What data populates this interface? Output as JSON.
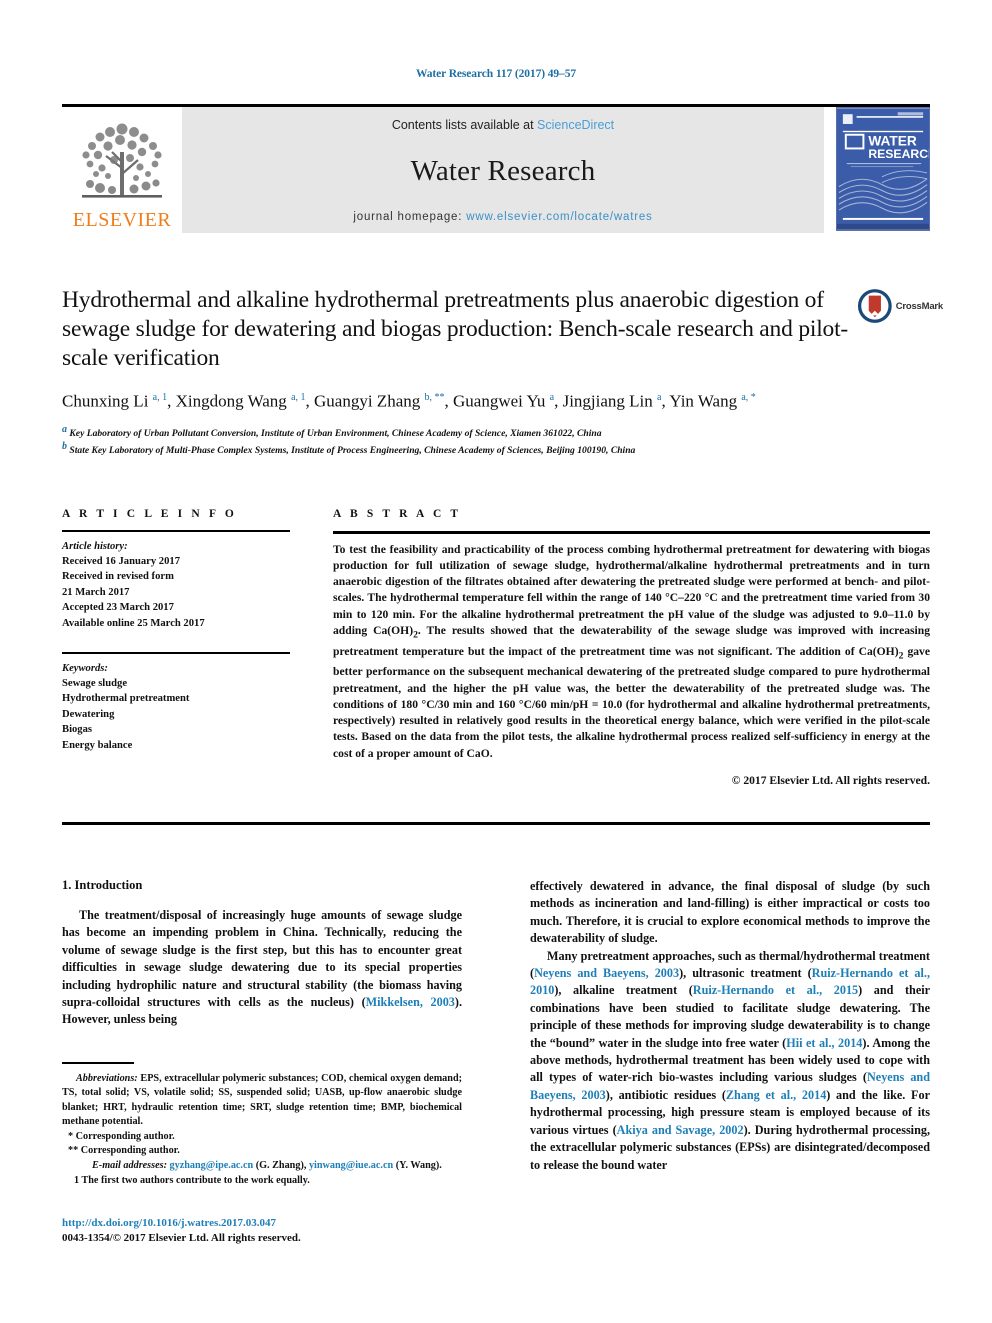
{
  "running_head": "Water Research 117 (2017) 49–57",
  "masthead": {
    "publisher_name": "ELSEVIER",
    "contents_prefix": "Contents lists available at ",
    "contents_link": "ScienceDirect",
    "journal_name": "Water Research",
    "homepage_prefix": "journal homepage: ",
    "homepage_url": "www.elsevier.com/locate/watres",
    "cover_title_line1": "WATER",
    "cover_title_line2": "RESEARCH"
  },
  "crossmark": {
    "label": "CrossMark"
  },
  "article": {
    "title": "Hydrothermal and alkaline hydrothermal pretreatments plus anaerobic digestion of sewage sludge for dewatering and biogas production: Bench-scale research and pilot-scale verification",
    "authors_html": "Chunxing Li <sup>a, 1</sup>, Xingdong Wang <sup>a, 1</sup>, Guangyi Zhang <sup>b, **</sup>, Guangwei Yu <sup>a</sup>, Jingjiang Lin <sup>a</sup>, Yin Wang <sup>a, *</sup>",
    "affiliation_a": "Key Laboratory of Urban Pollutant Conversion, Institute of Urban Environment, Chinese Academy of Science, Xiamen 361022, China",
    "affiliation_b": "State Key Laboratory of Multi-Phase Complex Systems, Institute of Process Engineering, Chinese Academy of Sciences, Beijing 100190, China"
  },
  "info": {
    "heading": "A R T I C L E   I N F O",
    "history_label": "Article history:",
    "history": [
      "Received 16 January 2017",
      "Received in revised form",
      "21 March 2017",
      "Accepted 23 March 2017",
      "Available online 25 March 2017"
    ],
    "keywords_label": "Keywords:",
    "keywords": [
      "Sewage sludge",
      "Hydrothermal pretreatment",
      "Dewatering",
      "Biogas",
      "Energy balance"
    ]
  },
  "abstract": {
    "heading": "A B S T R A C T",
    "text": "To test the feasibility and practicability of the process combing hydrothermal pretreatment for dewatering with biogas production for full utilization of sewage sludge, hydrothermal/alkaline hydrothermal pretreatments and in turn anaerobic digestion of the filtrates obtained after dewatering the pretreated sludge were performed at bench- and pilot-scales. The hydrothermal temperature fell within the range of 140 °C–220 °C and the pretreatment time varied from 30 min to 120 min. For the alkaline hydrothermal pretreatment the pH value of the sludge was adjusted to 9.0–11.0 by adding Ca(OH)2. The results showed that the dewaterability of the sewage sludge was improved with increasing pretreatment temperature but the impact of the pretreatment time was not significant. The addition of Ca(OH)2 gave better performance on the subsequent mechanical dewatering of the pretreated sludge compared to pure hydrothermal pretreatment, and the higher the pH value was, the better the dewaterability of the pretreated sludge was. The conditions of 180 °C/30 min and 160 °C/60 min/pH = 10.0 (for hydrothermal and alkaline hydrothermal pretreatments, respectively) resulted in relatively good results in the theoretical energy balance, which were verified in the pilot-scale tests. Based on the data from the pilot tests, the alkaline hydrothermal process realized self-sufficiency in energy at the cost of a proper amount of CaO.",
    "copyright": "© 2017 Elsevier Ltd. All rights reserved."
  },
  "body": {
    "section_heading": "1. Introduction",
    "left_paragraph_html": "The treatment/disposal of increasingly huge amounts of sewage sludge has become an impending problem in China. Technically, reducing the volume of sewage sludge is the first step, but this has to encounter great difficulties in sewage sludge dewatering due to its special properties including hydrophilic nature and structural stability (the biomass having supra-colloidal structures with cells as the nucleus) (<span class=\"ref\">Mikkelsen, 2003</span>). However, unless being",
    "right_paragraph1_html": "effectively dewatered in advance, the final disposal of sludge (by such methods as incineration and land-filling) is either impractical or costs too much. Therefore, it is crucial to explore economical methods to improve the dewaterability of sludge.",
    "right_paragraph2_html": "Many pretreatment approaches, such as thermal/hydrothermal treatment (<span class=\"ref\">Neyens and Baeyens, 2003</span>), ultrasonic treatment (<span class=\"ref\">Ruiz-Hernando et al., 2010</span>), alkaline treatment (<span class=\"ref\">Ruiz-Hernando et al., 2015</span>) and their combinations have been studied to facilitate sludge dewatering. The principle of these methods for improving sludge dewaterability is to change the “bound” water in the sludge into free water (<span class=\"ref\">Hii et al., 2014</span>). Among the above methods, hydrothermal treatment has been widely used to cope with all types of water-rich bio-wastes including various sludges (<span class=\"ref\">Neyens and Baeyens, 2003</span>), antibiotic residues (<span class=\"ref\">Zhang et al., 2014</span>) and the like. For hydrothermal processing, high pressure steam is employed because of its various virtues (<span class=\"ref\">Akiya and Savage, 2002</span>). During hydrothermal processing, the extracellular polymeric substances (EPSs) are disintegrated/decomposed to release the bound water"
  },
  "footnotes": {
    "abbreviations_html": "<i>Abbreviations:</i> EPS, extracellular polymeric substances; COD, chemical oxygen demand; TS, total solid; VS, volatile solid; SS, suspended solid; UASB, up-flow anaerobic sludge blanket; HRT, hydraulic retention time; SRT, sludge retention time; BMP, biochemical methane potential.",
    "corresponding_single": "* Corresponding author.",
    "corresponding_double": "** Corresponding author.",
    "email_html": "<i>E-mail addresses:</i> <span class=\"ref\">gyzhang@ipe.ac.cn</span> (G. Zhang), <span class=\"ref\">yinwang@iue.ac.cn</span> (Y. Wang).",
    "equal_contribution": "1  The first two authors contribute to the work equally."
  },
  "doi": {
    "url": "http://dx.doi.org/10.1016/j.watres.2017.03.047",
    "issn_line": "0043-1354/© 2017 Elsevier Ltd. All rights reserved."
  },
  "colors": {
    "link_blue": "#1d7fb8",
    "elsevier_orange": "#f07d1a",
    "band_gray": "#e6e6e6",
    "cover_blue": "#3b5ca8"
  }
}
